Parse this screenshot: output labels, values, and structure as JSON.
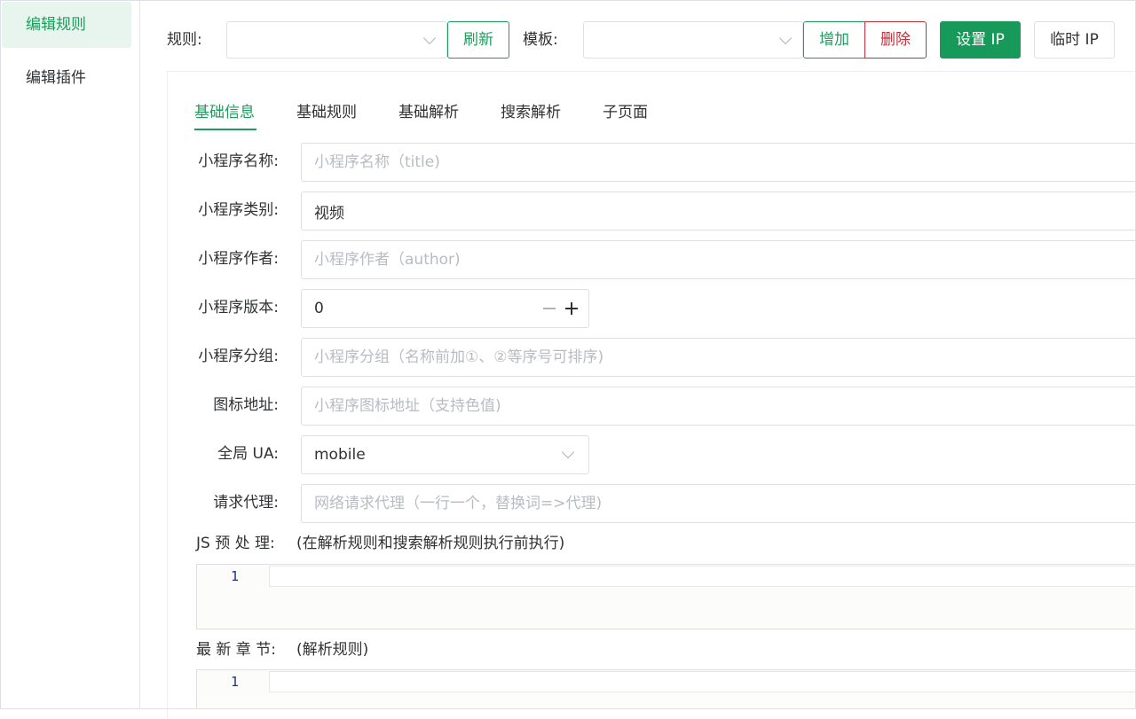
{
  "sidebar": {
    "items": [
      {
        "label": "编辑规则"
      },
      {
        "label": "编辑插件"
      }
    ]
  },
  "toolbar": {
    "rule_label": "规则:",
    "refresh": "刷新",
    "template_label": "模板:",
    "add": "增加",
    "delete": "删除",
    "set_ip": "设置 IP",
    "temp_ip": "临时 IP"
  },
  "tabs": [
    {
      "label": "基础信息",
      "active": true
    },
    {
      "label": "基础规则"
    },
    {
      "label": "基础解析"
    },
    {
      "label": "搜索解析"
    },
    {
      "label": "子页面"
    }
  ],
  "form": {
    "name": {
      "label": "小程序名称:",
      "placeholder": "小程序名称（title)"
    },
    "category": {
      "label": "小程序类别:",
      "value": "视频"
    },
    "author": {
      "label": "小程序作者:",
      "placeholder": "小程序作者（author)"
    },
    "version": {
      "label": "小程序版本:",
      "value": "0"
    },
    "group": {
      "label": "小程序分组:",
      "placeholder": "小程序分组（名称前加①、②等序号可排序)"
    },
    "icon": {
      "label": "图标地址:",
      "placeholder": "小程序图标地址（支持色值)"
    },
    "ua": {
      "label": "全局 UA:",
      "value": "mobile"
    },
    "proxy": {
      "label": "请求代理:",
      "placeholder": "网络请求代理（一行一个，替换词=>代理)"
    }
  },
  "sections": {
    "js_pre": {
      "label": "JS 预 处 理:",
      "note": "(在解析规则和搜索解析规则执行前执行)",
      "line": "1"
    },
    "latest": {
      "label": "最 新 章 节:",
      "note": "(解析规则)",
      "line": "1"
    }
  },
  "colors": {
    "accent": "#1a9f5b",
    "danger": "#c0303a"
  }
}
